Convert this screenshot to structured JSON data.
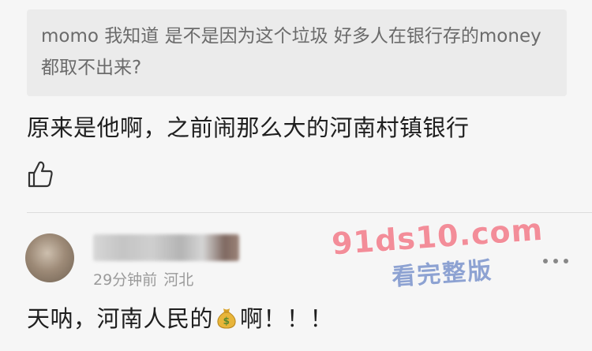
{
  "quote": {
    "text": "momo 我知道 是不是因为这个垃圾 好多人在银行存的money都取不出来?"
  },
  "reply": {
    "text": "原来是他啊，之前闹那么大的河南村镇银行"
  },
  "comment": {
    "time": "29分钟前",
    "location": "河北",
    "text_before_emoji": "天呐，河南人民的",
    "emoji": "money-bag",
    "text_after_emoji": "啊！！！"
  },
  "watermark": {
    "url": "91ds10.com",
    "subtitle": "看完整版"
  },
  "icons": {
    "like": "thumbs-up-icon",
    "more": "more-dots-icon",
    "avatar": "user-avatar"
  },
  "colors": {
    "background": "#f6f6f6",
    "quote_bg": "#ebebeb",
    "meta": "#9a9a9a",
    "watermark_pink": "#f26a7a",
    "watermark_blue": "#6a86c7"
  }
}
